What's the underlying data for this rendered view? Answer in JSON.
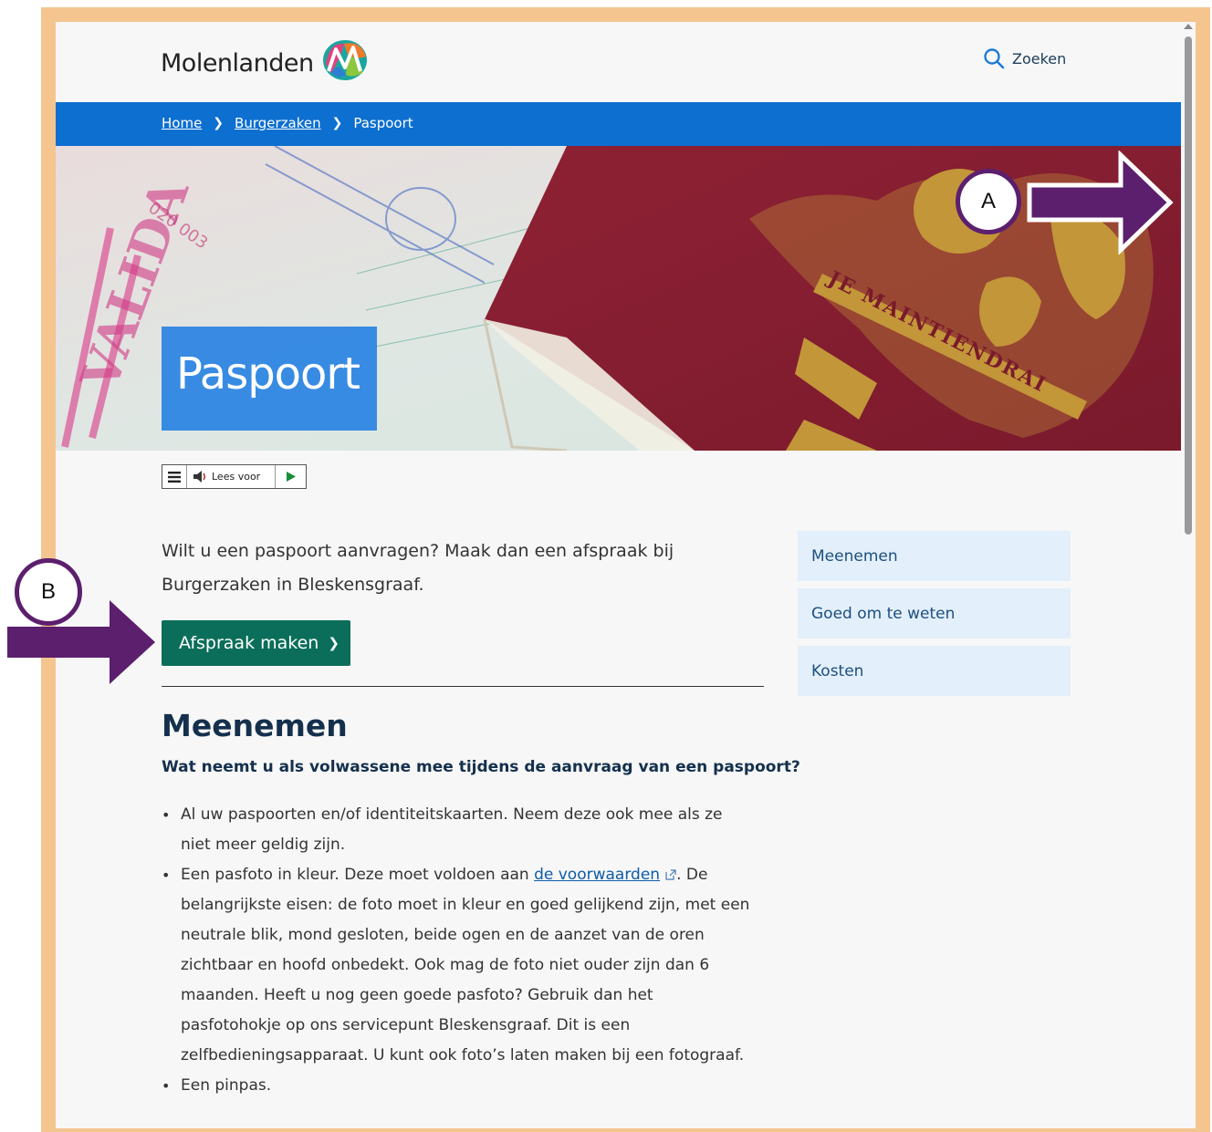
{
  "header": {
    "logo_text": "Molenlanden",
    "search_label": "Zoeken"
  },
  "breadcrumb": {
    "items": [
      {
        "label": "Home",
        "link": true
      },
      {
        "label": "Burgerzaken",
        "link": true
      },
      {
        "label": "Paspoort",
        "link": false
      }
    ]
  },
  "hero": {
    "title": "Paspoort"
  },
  "readspeaker": {
    "label": "Lees voor"
  },
  "main": {
    "intro": "Wilt u een paspoort aanvragen? Maak dan een afspraak bij Burgerzaken in Bleskensgraaf.",
    "cta_label": "Afspraak maken",
    "section_title": "Meenemen",
    "section_subtitle": "Wat neemt u als volwassene mee tijdens de aanvraag van een paspoort?",
    "list": {
      "item1": "Al uw paspoorten en/of identiteitskaarten. Neem deze ook mee als ze niet meer geldig zijn.",
      "item2_before": "Een pasfoto in kleur. Deze moet voldoen aan ",
      "item2_link": "de voorwaarden",
      "item2_after": ". De belangrijkste eisen: de foto moet in kleur en goed gelijkend zijn, met een neutrale blik, mond gesloten, beide ogen en de aanzet van de oren zichtbaar en hoofd onbedekt. Ook mag de foto niet ouder zijn dan 6 maanden. Heeft u nog geen goede pasfoto? Gebruik dan het pasfotohokje op ons servicepunt Bleskensgraaf. Dit is een zelfbedieningsapparaat. U kunt ook foto’s laten maken bij een fotograaf.",
      "item3": "Een pinpas."
    }
  },
  "sidenav": {
    "items": [
      "Meenemen",
      "Goed om te weten",
      "Kosten"
    ]
  },
  "annotations": {
    "a_label": "A",
    "b_label": "B",
    "color": "#5c1f6e"
  },
  "colors": {
    "frame": "#f4c58f",
    "breadcrumb_bar": "#0d6fd0",
    "cta": "#0b6e5a",
    "sidenav_bg": "#e3effa",
    "hero_title_bg": "#2b83e2"
  }
}
